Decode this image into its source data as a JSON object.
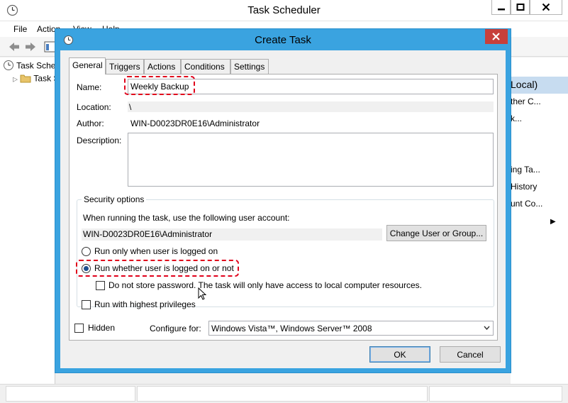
{
  "main_window": {
    "title": "Task Scheduler",
    "menu": [
      "File",
      "Action",
      "View",
      "Help"
    ],
    "tree": [
      {
        "label": "Task Scheduler"
      },
      {
        "label": "Task Scheduler Library"
      }
    ],
    "actions_pane": {
      "header": "Local)",
      "items": [
        "ther C...",
        "k...",
        "ing Ta...",
        "History",
        "unt Co..."
      ]
    }
  },
  "dialog": {
    "title": "Create Task",
    "tabs": [
      "General",
      "Triggers",
      "Actions",
      "Conditions",
      "Settings"
    ],
    "active_tab": "General",
    "fields": {
      "name_label": "Name:",
      "name_value": "Weekly Backup",
      "location_label": "Location:",
      "location_value": "\\",
      "author_label": "Author:",
      "author_value": "WIN-D0023DR0E16\\Administrator",
      "description_label": "Description:",
      "description_value": ""
    },
    "security": {
      "group_title": "Security options",
      "account_prompt": "When running the task, use the following user account:",
      "account_value": "WIN-D0023DR0E16\\Administrator",
      "change_button": "Change User or Group...",
      "radio_logged_on": "Run only when user is logged on",
      "radio_whether": "Run whether user is logged on or not",
      "selected_radio": "whether",
      "no_store_password": "Do not store password.  The task will only have access to local computer resources.",
      "no_store_password_checked": false,
      "highest_privileges": "Run with highest privileges",
      "highest_privileges_checked": false
    },
    "hidden_label": "Hidden",
    "hidden_checked": false,
    "configure_label": "Configure for:",
    "configure_value": "Windows Vista™, Windows Server™ 2008",
    "ok_button": "OK",
    "cancel_button": "Cancel"
  },
  "colors": {
    "dialog_frame": "#3aa3e0",
    "close_button": "#c7403b",
    "highlight": "#e0001a",
    "actions_header": "#c7dcf0"
  }
}
